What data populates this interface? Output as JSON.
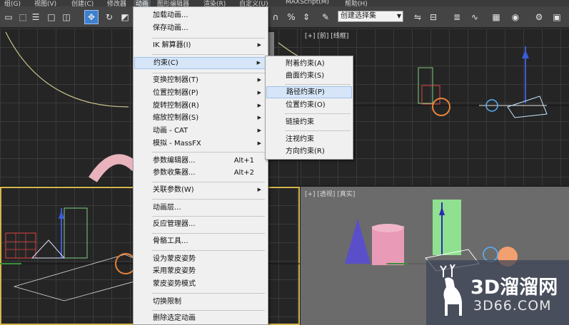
{
  "menubar": {
    "items": [
      "组(G)",
      "视图(V)",
      "创建(C)",
      "修改器",
      "动画",
      "图形编辑器",
      "渲染(R)",
      "自定义(U)",
      "MAXScript(M)",
      "帮助(H)"
    ]
  },
  "toolbar": {
    "selection_set": "创建选择集"
  },
  "viewports": {
    "top_right_label": "[+] [前] [线框]",
    "bottom_right_label": "[+] [透视] [真实]"
  },
  "animation_menu": {
    "items": [
      {
        "label": "加载动画..."
      },
      {
        "label": "保存动画..."
      },
      {
        "label": "IK 解算器(I)",
        "submenu": true
      },
      {
        "label": "约束(C)",
        "submenu": true,
        "highlighted": true
      },
      {
        "label": "变换控制器(T)",
        "submenu": true
      },
      {
        "label": "位置控制器(P)",
        "submenu": true
      },
      {
        "label": "旋转控制器(R)",
        "submenu": true
      },
      {
        "label": "缩放控制器(S)",
        "submenu": true
      },
      {
        "label": "动画 - CAT",
        "submenu": true
      },
      {
        "label": "模拟 - MassFX",
        "submenu": true
      },
      {
        "label": "参数编辑器...",
        "shortcut": "Alt+1"
      },
      {
        "label": "参数收集器...",
        "shortcut": "Alt+2"
      },
      {
        "label": "关联参数(W)",
        "submenu": true
      },
      {
        "label": "动画层..."
      },
      {
        "label": "反应管理器..."
      },
      {
        "label": "骨骼工具..."
      },
      {
        "label": "设为蒙皮姿势"
      },
      {
        "label": "采用蒙皮姿势"
      },
      {
        "label": "蒙皮姿势模式"
      },
      {
        "label": "切换限制"
      },
      {
        "label": "删除选定动画"
      }
    ]
  },
  "constraint_submenu": {
    "items": [
      {
        "label": "附着约束(A)"
      },
      {
        "label": "曲面约束(S)"
      },
      {
        "label": "路径约束(P)",
        "highlighted": true
      },
      {
        "label": "位置约束(O)"
      },
      {
        "label": "链接约束"
      },
      {
        "label": "注视约束"
      },
      {
        "label": "方向约束(R)"
      }
    ]
  },
  "watermark": {
    "brand": "3D溜溜网",
    "domain": "3D66.COM"
  },
  "colors": {
    "menu_bg": "#f0f0f0",
    "menu_highlight": "#d6e6f8",
    "toolbar_selected": "#3e7fcf",
    "viewport_active_border": "#d5b44a"
  }
}
